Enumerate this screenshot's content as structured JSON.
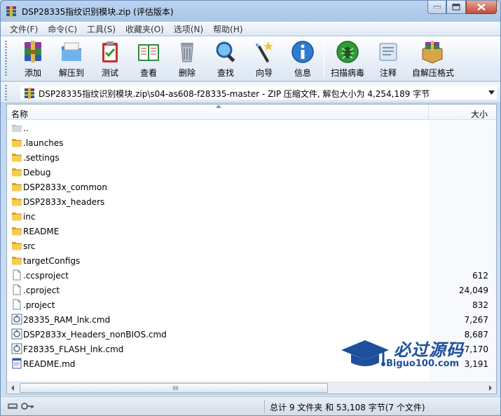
{
  "window": {
    "title": "DSP28335指纹识别模块.zip (评估版本)"
  },
  "menu": [
    "文件(F)",
    "命令(C)",
    "工具(S)",
    "收藏夹(O)",
    "选项(N)",
    "帮助(H)"
  ],
  "toolbar": {
    "add": "添加",
    "extract": "解压到",
    "test": "测试",
    "view": "查看",
    "delete": "删除",
    "find": "查找",
    "wizard": "向导",
    "info": "信息",
    "scan": "扫描病毒",
    "comment": "注释",
    "sfx": "自解压格式"
  },
  "address": {
    "text": "DSP28335指纹识别模块.zip\\s04-as608-f28335-master - ZIP 压缩文件, 解包大小为 4,254,189 字节"
  },
  "columns": {
    "name": "名称",
    "size": "大小"
  },
  "files": [
    {
      "name": "..",
      "size": "",
      "type": "up"
    },
    {
      "name": ".launches",
      "size": "",
      "type": "folder"
    },
    {
      "name": ".settings",
      "size": "",
      "type": "folder"
    },
    {
      "name": "Debug",
      "size": "",
      "type": "folder"
    },
    {
      "name": "DSP2833x_common",
      "size": "",
      "type": "folder"
    },
    {
      "name": "DSP2833x_headers",
      "size": "",
      "type": "folder"
    },
    {
      "name": "inc",
      "size": "",
      "type": "folder"
    },
    {
      "name": "README",
      "size": "",
      "type": "folder"
    },
    {
      "name": "src",
      "size": "",
      "type": "folder"
    },
    {
      "name": "targetConfigs",
      "size": "",
      "type": "folder"
    },
    {
      "name": ".ccsproject",
      "size": "612",
      "type": "file"
    },
    {
      "name": ".cproject",
      "size": "24,049",
      "type": "file"
    },
    {
      "name": ".project",
      "size": "832",
      "type": "file"
    },
    {
      "name": "28335_RAM_lnk.cmd",
      "size": "7,267",
      "type": "cmd"
    },
    {
      "name": "DSP2833x_Headers_nonBIOS.cmd",
      "size": "8,687",
      "type": "cmd"
    },
    {
      "name": "F28335_FLASH_lnk.cmd",
      "size": "7,170",
      "type": "cmd"
    },
    {
      "name": "README.md",
      "size": "3,191",
      "type": "md"
    }
  ],
  "status": {
    "summary": "总计 9 文件夹 和 53,108 字节(7 个文件)"
  },
  "watermark": {
    "main": "必过源码",
    "sub": "Biguo100.com"
  }
}
